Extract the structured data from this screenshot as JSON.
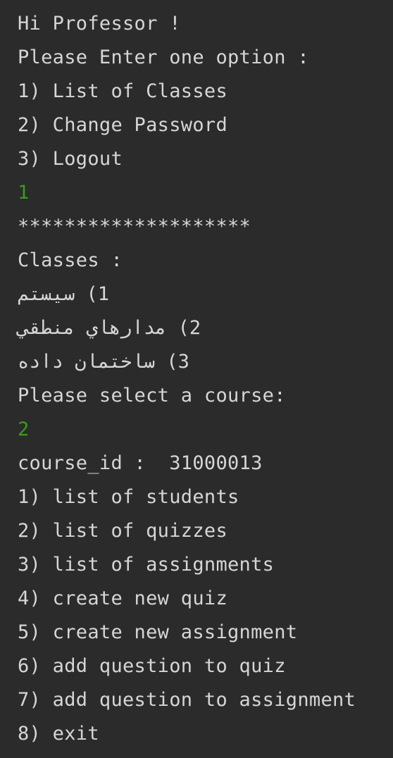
{
  "console": {
    "lines": [
      {
        "text": "Hi Professor !",
        "kind": "output"
      },
      {
        "text": "Please Enter one option :",
        "kind": "output"
      },
      {
        "text": "1) List of Classes",
        "kind": "output"
      },
      {
        "text": "2) Change Password",
        "kind": "output"
      },
      {
        "text": "3) Logout",
        "kind": "output"
      },
      {
        "text": "1",
        "kind": "input"
      },
      {
        "text": "********************",
        "kind": "output"
      },
      {
        "text": "Classes :",
        "kind": "output"
      },
      {
        "text": "1) سیستم",
        "kind": "output-rtl"
      },
      {
        "text": "2) مدارهاي منطقي",
        "kind": "output-rtl"
      },
      {
        "text": "3) ساختمان داده",
        "kind": "output-rtl"
      },
      {
        "text": "Please select a course:",
        "kind": "output"
      },
      {
        "text": "2",
        "kind": "input"
      },
      {
        "text": "course_id :  31000013",
        "kind": "output"
      },
      {
        "text": "1) list of students",
        "kind": "output"
      },
      {
        "text": "2) list of quizzes",
        "kind": "output"
      },
      {
        "text": "3) list of assignments",
        "kind": "output"
      },
      {
        "text": "4) create new quiz",
        "kind": "output"
      },
      {
        "text": "5) create new assignment",
        "kind": "output"
      },
      {
        "text": "6) add question to quiz",
        "kind": "output"
      },
      {
        "text": "7) add question to assignment",
        "kind": "output"
      },
      {
        "text": "8) exit",
        "kind": "output"
      }
    ]
  },
  "colors": {
    "background": "#2b2b2b",
    "output_text": "#d6d6d6",
    "user_input": "#3b9a1e"
  }
}
